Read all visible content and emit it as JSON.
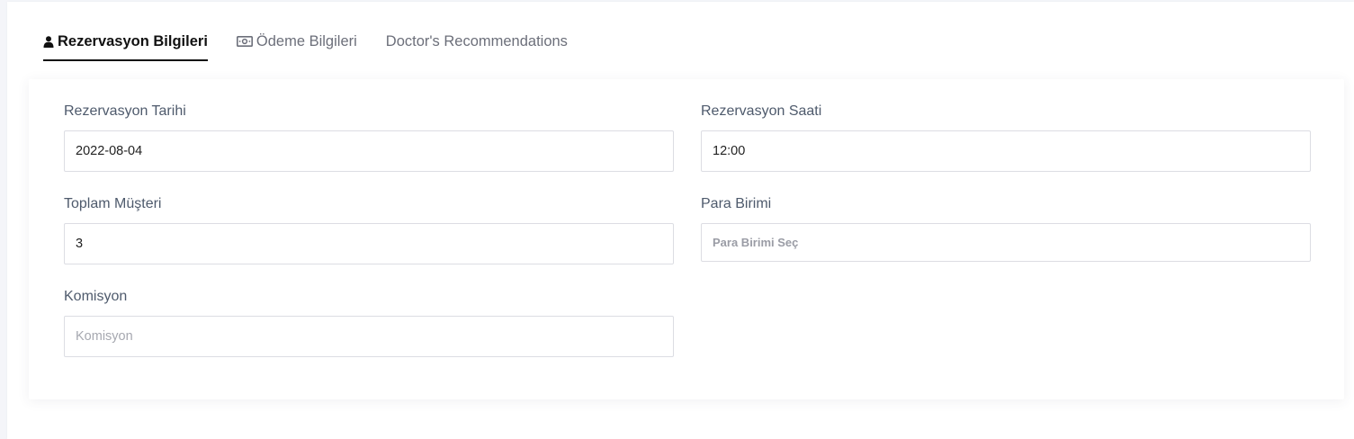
{
  "tabs": [
    {
      "label": "Rezervasyon Bilgileri",
      "icon": "user-icon",
      "active": true
    },
    {
      "label": "Ödeme Bilgileri",
      "icon": "money-bill-icon",
      "active": false
    },
    {
      "label": "Doctor's Recommendations",
      "active": false
    }
  ],
  "form": {
    "reservation_date": {
      "label": "Rezervasyon Tarihi",
      "value": "2022-08-04"
    },
    "reservation_time": {
      "label": "Rezervasyon Saati",
      "value": "12:00"
    },
    "total_customers": {
      "label": "Toplam Müşteri",
      "value": "3"
    },
    "currency": {
      "label": "Para Birimi",
      "placeholder": "Para Birimi Seç"
    },
    "commission": {
      "label": "Komisyon",
      "placeholder": "Komisyon",
      "value": ""
    }
  },
  "colors": {
    "active_tab": "#111111",
    "inactive_tab": "#6c6f7a",
    "label": "#4e5a6c",
    "border": "#dcdde3"
  }
}
